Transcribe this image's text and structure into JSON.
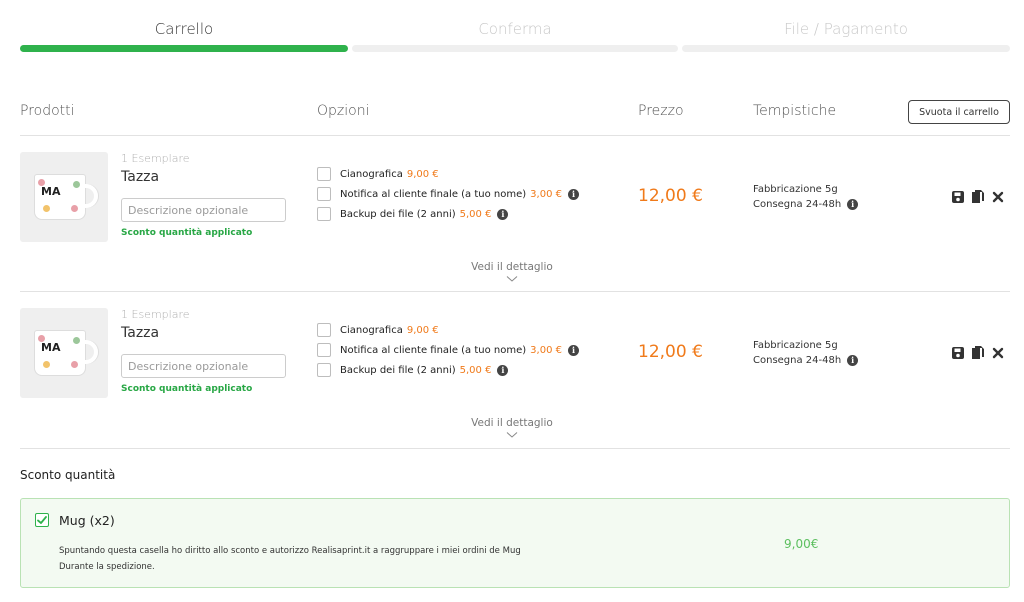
{
  "steps": [
    {
      "label": "Carrello",
      "active": true
    },
    {
      "label": "Conferma",
      "active": false
    },
    {
      "label": "File / Pagamento",
      "active": false
    }
  ],
  "columns": {
    "products": "Prodotti",
    "options": "Opzioni",
    "price": "Prezzo",
    "timing": "Tempistiche"
  },
  "empty_cart_label": "Svuota il carrello",
  "items": [
    {
      "quantity": "1 Esemplare",
      "name": "Tazza",
      "description_placeholder": "Descrizione opzionale",
      "description_value": "",
      "discount_note": "Sconto quantità applicato",
      "mug_print": "MA",
      "options": [
        {
          "label": "Cianografica",
          "price": "9,00 €",
          "checked": false,
          "info": false
        },
        {
          "label": "Notifica al cliente finale (a tuo nome)",
          "price": "3,00 €",
          "checked": false,
          "info": true
        },
        {
          "label": "Backup dei file (2 anni)",
          "price": "5,00 €",
          "checked": false,
          "info": true
        }
      ],
      "price": "12,00 €",
      "fabrication": "Fabbricazione 5g",
      "delivery": "Consegna 24-48h",
      "detail_link": "Vedi il dettaglio"
    },
    {
      "quantity": "1 Esemplare",
      "name": "Tazza",
      "description_placeholder": "Descrizione opzionale",
      "description_value": "",
      "discount_note": "Sconto quantità applicato",
      "mug_print": "MA",
      "options": [
        {
          "label": "Cianografica",
          "price": "9,00 €",
          "checked": false,
          "info": false
        },
        {
          "label": "Notifica al cliente finale (a tuo nome)",
          "price": "3,00 €",
          "checked": false,
          "info": true
        },
        {
          "label": "Backup dei file (2 anni)",
          "price": "5,00 €",
          "checked": false,
          "info": true
        }
      ],
      "price": "12,00 €",
      "fabrication": "Fabbricazione 5g",
      "delivery": "Consegna 24-48h",
      "detail_link": "Vedi il dettaglio"
    }
  ],
  "quantity_discount": {
    "title": "Sconto quantità",
    "name": "Mug (x2)",
    "checked": true,
    "text": "Spuntando questa casella ho diritto allo sconto e autorizzo Realisaprint.it a raggruppare i miei ordini de Mug Durante la spedizione.",
    "amount": "9,00€"
  },
  "colors": {
    "accent_green": "#2fb24c",
    "price_orange": "#f07a1a",
    "discount_bg": "#f3faf2"
  },
  "icons": {
    "info": "info-icon",
    "save": "save-icon",
    "copy": "copy-icon",
    "remove": "close-icon",
    "expand": "chevron-down-icon",
    "check": "check-icon"
  }
}
